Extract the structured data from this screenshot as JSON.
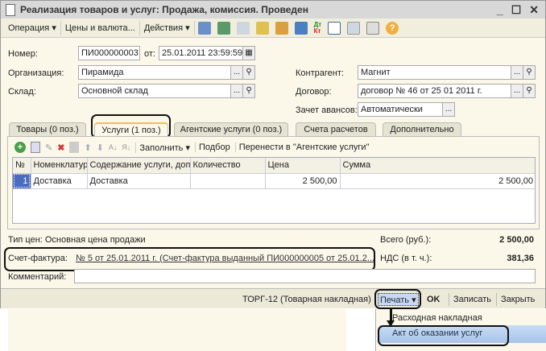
{
  "title": "Реализация товаров и услуг: Продажа, комиссия. Проведен",
  "window_controls": [
    "_",
    "☐",
    "✕"
  ],
  "toolbar": {
    "operation": "Операция",
    "prices": "Цены и валюта...",
    "actions": "Действия",
    "dt": "Дт",
    "kt": "Кт",
    "help": "?"
  },
  "form": {
    "number_label": "Номер:",
    "number": "ПИ000000003",
    "date_label": "от:",
    "date": "25.01.2011 23:59:59",
    "org_label": "Организация:",
    "org": "Пирамида",
    "warehouse_label": "Склад:",
    "warehouse": "Основной склад",
    "counterparty_label": "Контрагент:",
    "counterparty": "Магнит",
    "contract_label": "Договор:",
    "contract": "договор № 46 от 25 01 2011 г.",
    "advance_label": "Зачет авансов:",
    "advance": "Автоматически",
    "dots": "..."
  },
  "tabs": [
    "Товары (0 поз.)",
    "Услуги (1 поз.)",
    "Агентские услуги (0 поз.)",
    "Счета расчетов",
    "Дополнительно"
  ],
  "panel_toolbar": {
    "fill": "Заполнить",
    "pick": "Подбор",
    "move": "Перенести в \"Агентские услуги\""
  },
  "table": {
    "headers": [
      "№",
      "Номенклатура",
      "Содержание услуги, доп. све...",
      "Количество",
      "Цена",
      "Сумма"
    ],
    "rows": [
      [
        "1",
        "Доставка",
        "Доставка",
        "",
        "2 500,00",
        "2 500,00"
      ]
    ]
  },
  "price_type": "Тип цен: Основная цена продажи",
  "total_label": "Всего (руб.):",
  "total": "2 500,00",
  "vat_label": "НДС (в т. ч.):",
  "vat": "381,36",
  "invoice_label": "Счет-фактура:",
  "invoice": "№ 5 от 25.01.2011 г. (Счет-фактура выданный ПИ000000005 от 25.01.2...",
  "comment_label": "Комментарий:",
  "footer": {
    "torg": "ТОРГ-12 (Товарная накладная)",
    "print": "Печать",
    "ok": "OK",
    "save": "Записать",
    "close": "Закрыть"
  },
  "print_menu": [
    "Расходная накладная",
    "Акт об оказании услуг"
  ]
}
